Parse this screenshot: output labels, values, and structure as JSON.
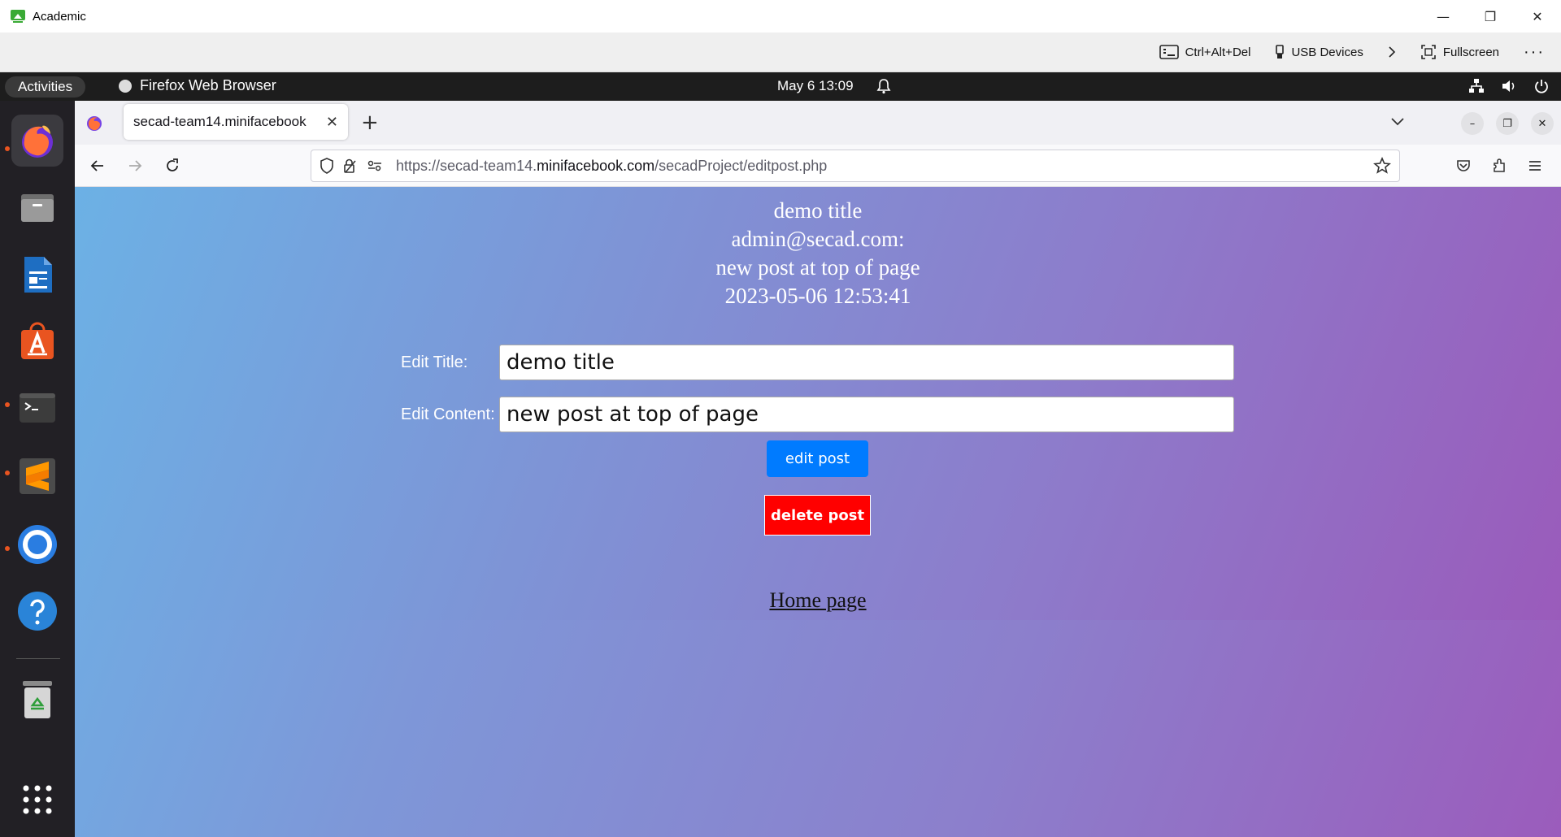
{
  "host": {
    "title": "Academic",
    "toolbar": {
      "cad_label": "Ctrl+Alt+Del",
      "usb_label": "USB Devices",
      "fullscreen_label": "Fullscreen"
    }
  },
  "topbar": {
    "activities_label": "Activities",
    "app_name": "Firefox Web Browser",
    "clock": "May 6  13:09"
  },
  "browser": {
    "tab_title": "secad-team14.minifacebook",
    "url_prefix": "https://secad-team14.",
    "url_domain": "minifacebook.com",
    "url_suffix": "/secadProject/editpost.php"
  },
  "post": {
    "title": "demo title",
    "author": "admin@secad.com:",
    "content": "new post at top of page",
    "timestamp": "2023-05-06 12:53:41"
  },
  "form": {
    "title_label": "Edit Title:",
    "title_value": "demo title",
    "content_label": "Edit Content:",
    "content_value": "new post at top of page",
    "edit_button": "edit post",
    "delete_button": "delete post"
  },
  "footer": {
    "home_link": "Home page"
  },
  "colors": {
    "edit_button": "#007bff",
    "delete_button": "#ff0000",
    "dock_bg": "#222025",
    "topbar_bg": "#1d1d1d"
  }
}
